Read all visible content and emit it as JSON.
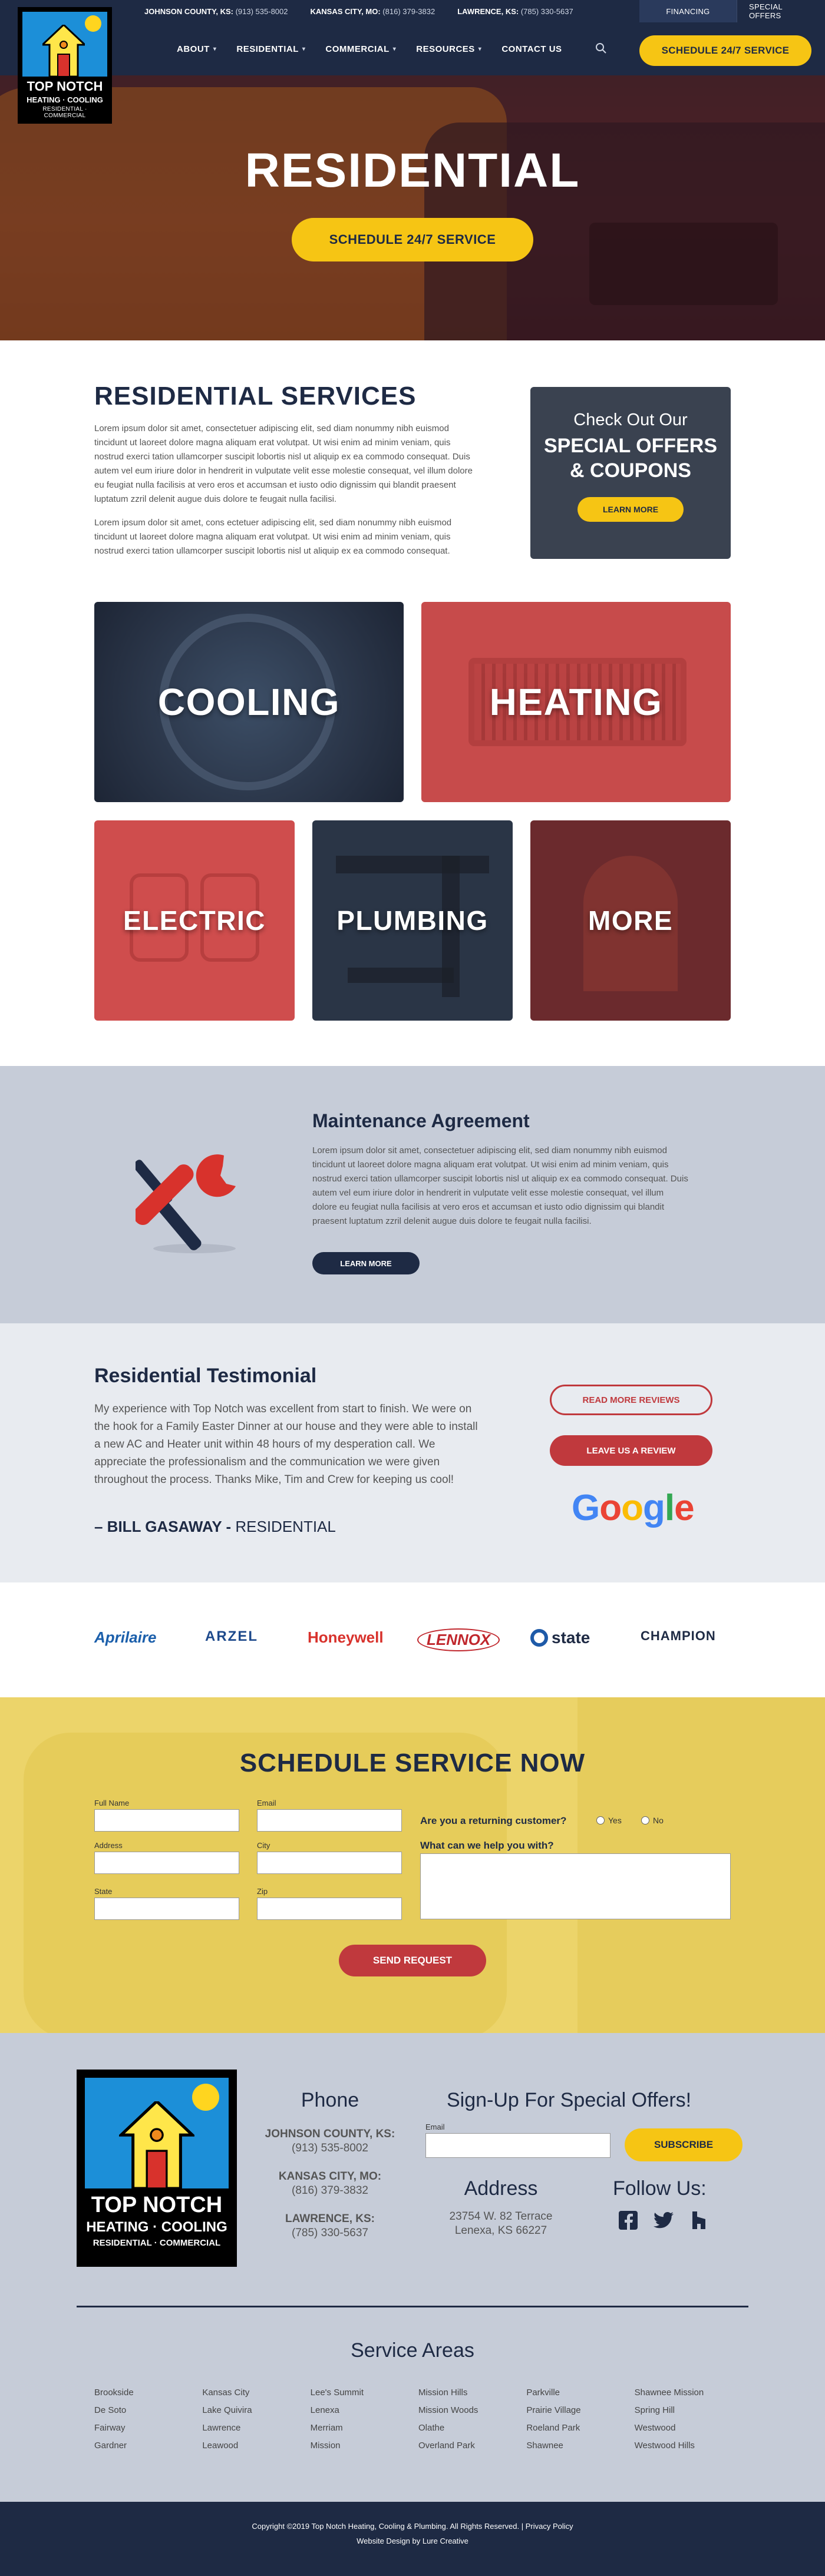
{
  "topbar": {
    "phones": [
      {
        "region": "JOHNSON COUNTY, KS:",
        "number": "(913) 535-8002"
      },
      {
        "region": "KANSAS CITY, MO:",
        "number": "(816) 379-3832"
      },
      {
        "region": "LAWRENCE, KS:",
        "number": "(785) 330-5637"
      }
    ],
    "financing": "FINANCING",
    "special_offers": "SPECIAL OFFERS"
  },
  "logo": {
    "line1": "TOP NOTCH",
    "line2": "HEATING · COOLING",
    "line3": "RESIDENTIAL · COMMERCIAL"
  },
  "nav": {
    "items": [
      {
        "label": "ABOUT",
        "dropdown": true
      },
      {
        "label": "RESIDENTIAL",
        "dropdown": true
      },
      {
        "label": "COMMERCIAL",
        "dropdown": true
      },
      {
        "label": "RESOURCES",
        "dropdown": true
      },
      {
        "label": "CONTACT US",
        "dropdown": false
      }
    ],
    "schedule_button": "SCHEDULE 24/7 SERVICE"
  },
  "hero": {
    "title": "RESIDENTIAL",
    "button": "SCHEDULE 24/7 SERVICE"
  },
  "services": {
    "title": "RESIDENTIAL SERVICES",
    "para1": "Lorem ipsum dolor sit amet, consectetuer adipiscing elit, sed diam nonummy nibh euismod tincidunt ut laoreet dolore magna aliquam erat volutpat. Ut wisi enim ad minim veniam, quis nostrud exerci tation ullamcorper suscipit lobortis nisl ut aliquip ex ea commodo consequat. Duis autem vel eum iriure dolor in hendrerit in vulputate velit esse molestie consequat, vel illum dolore eu feugiat nulla facilisis at vero eros et accumsan et iusto odio dignissim qui blandit praesent luptatum zzril delenit augue duis dolore te feugait nulla facilisi.",
    "para2": "Lorem ipsum dolor sit amet, cons ectetuer adipiscing elit, sed diam nonummy nibh euismod tincidunt ut laoreet dolore magna aliquam erat volutpat. Ut wisi enim ad minim veniam, quis nostrud exerci tation ullamcorper suscipit lobortis nisl ut aliquip ex ea commodo consequat.",
    "offers": {
      "line1": "Check Out Our",
      "line2": "SPECIAL OFFERS",
      "line3": "& COUPONS",
      "button": "LEARN MORE"
    }
  },
  "tiles": {
    "cooling": "COOLING",
    "heating": "HEATING",
    "electric": "ELECTRIC",
    "plumbing": "PLUMBING",
    "more": "MORE"
  },
  "maintenance": {
    "title": "Maintenance Agreement",
    "text": "Lorem ipsum dolor sit amet, consectetuer adipiscing elit, sed diam nonummy nibh euismod tincidunt ut laoreet dolore magna aliquam erat volutpat. Ut wisi enim ad minim veniam, quis nostrud exerci tation ullamcorper suscipit lobortis nisl ut aliquip ex ea commodo consequat. Duis autem vel eum iriure dolor in hendrerit in vulputate velit esse molestie consequat, vel illum dolore eu feugiat nulla facilisis at vero eros et accumsan et iusto odio dignissim qui blandit praesent luptatum zzril delenit augue duis dolore te feugait nulla facilisi.",
    "button": "LEARN MORE"
  },
  "testimonial": {
    "title": "Residential Testimonial",
    "quote": "My experience with Top Notch was excellent from start to finish. We were on the hook for a Family Easter Dinner at our house and they were able to install a new AC and Heater unit within 48 hours of my desperation call. We appreciate the professionalism and the communication we were given throughout the process. Thanks Mike, Tim and Crew for keeping us cool!",
    "author": "– BILL GASAWAY -",
    "author_type": "RESIDENTIAL",
    "read_more": "READ MORE REVIEWS",
    "leave_review": "LEAVE US A REVIEW",
    "google": "Google"
  },
  "brands": [
    "Aprilaire",
    "ARZEL",
    "Honeywell",
    "LENNOX",
    "state",
    "CHAMPION"
  ],
  "schedule": {
    "title": "SCHEDULE SERVICE NOW",
    "labels": {
      "full_name": "Full Name",
      "email": "Email",
      "address": "Address",
      "city": "City",
      "state": "State",
      "zip": "Zip"
    },
    "returning_q": "Are you a returning customer?",
    "yes": "Yes",
    "no": "No",
    "help_q": "What can we help you with?",
    "send": "SEND REQUEST"
  },
  "footer": {
    "logo": {
      "line1": "TOP NOTCH",
      "line2": "HEATING · COOLING",
      "line3": "RESIDENTIAL · COMMERCIAL"
    },
    "phone_title": "Phone",
    "phones": [
      {
        "region": "JOHNSON COUNTY, KS:",
        "number": "(913) 535-8002"
      },
      {
        "region": "KANSAS CITY, MO:",
        "number": "(816) 379-3832"
      },
      {
        "region": "LAWRENCE, KS:",
        "number": "(785) 330-5637"
      }
    ],
    "signup_title": "Sign-Up For Special Offers!",
    "email_label": "Email",
    "subscribe": "SUBSCRIBE",
    "address_title": "Address",
    "address1": "23754 W. 82 Terrace",
    "address2": "Lenexa, KS 66227",
    "follow_title": "Follow Us:",
    "service_areas_title": "Service Areas",
    "cities": [
      "Brookside",
      "Kansas City",
      "Lee's Summit",
      "Mission Hills",
      "Parkville",
      "Shawnee Mission",
      "De Soto",
      "Lake Quivira",
      "Lenexa",
      "Mission Woods",
      "Prairie Village",
      "Spring Hill",
      "Fairway",
      "Lawrence",
      "Merriam",
      "Olathe",
      "Roeland Park",
      "Westwood",
      "Gardner",
      "Leawood",
      "Mission",
      "Overland Park",
      "Shawnee",
      "Westwood Hills"
    ]
  },
  "copyright": {
    "line1": "Copyright ©2019 Top Notch Heating, Cooling & Plumbing. All Rights Reserved.",
    "privacy": "Privacy Policy",
    "line2": "Website Design by Lure Creative"
  }
}
